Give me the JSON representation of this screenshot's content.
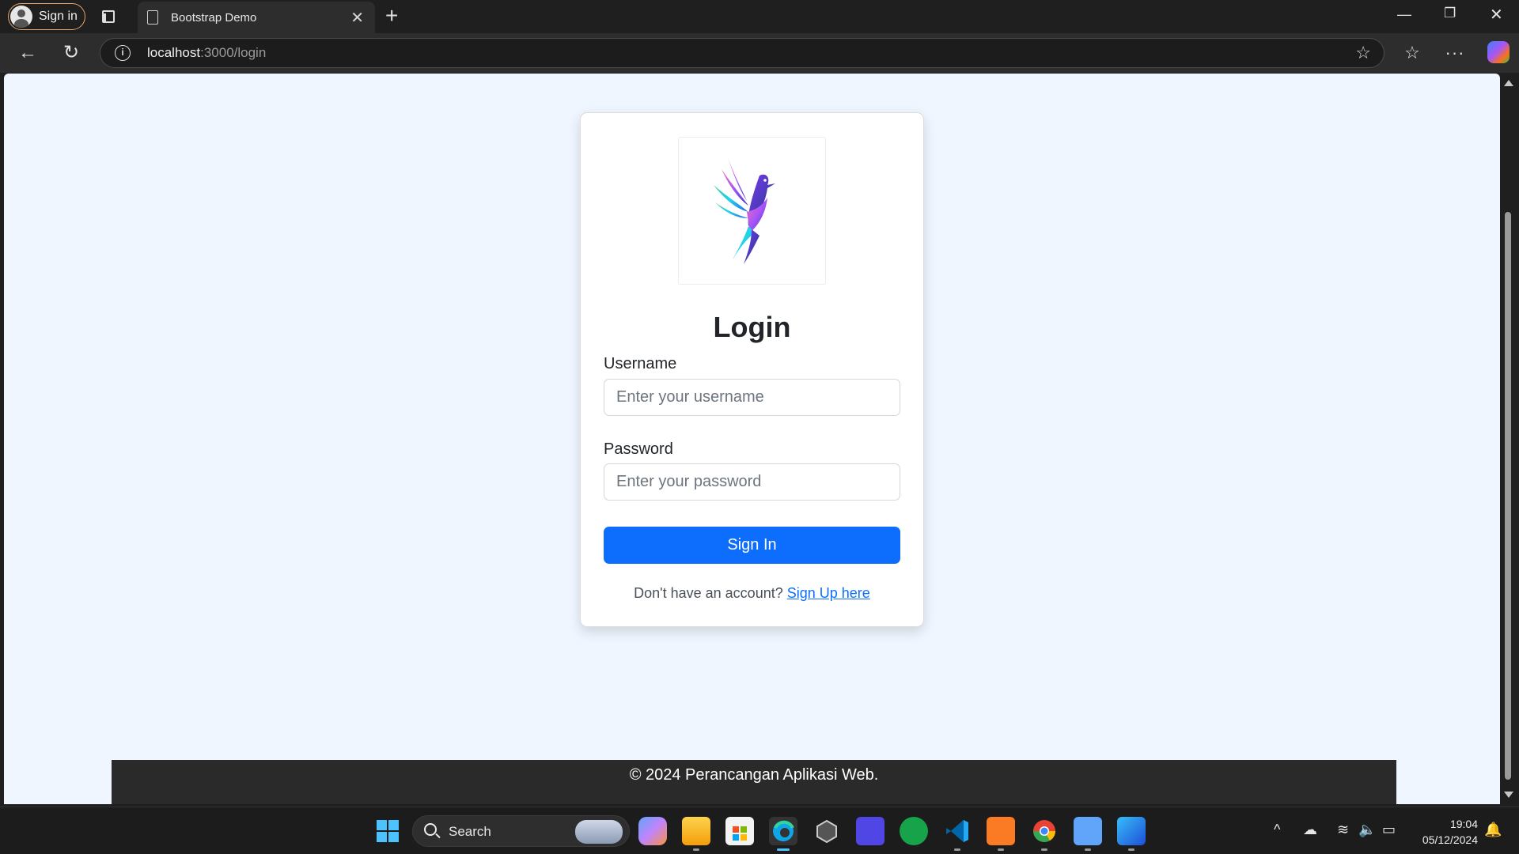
{
  "browser": {
    "profile_label": "Sign in",
    "tab_title": "Bootstrap Demo",
    "url_host": "localhost",
    "url_path": ":3000/login"
  },
  "login": {
    "title": "Login",
    "username_label": "Username",
    "username_placeholder": "Enter your username",
    "password_label": "Password",
    "password_placeholder": "Enter your password",
    "submit_label": "Sign In",
    "signup_prompt": "Don't have an account?",
    "signup_link": "Sign Up here"
  },
  "footer": {
    "text": "© 2024 Perancangan Aplikasi Web."
  },
  "taskbar": {
    "search_label": "Search",
    "time": "19:04",
    "date": "05/12/2024"
  },
  "colors": {
    "page_bg": "#eff6ff",
    "primary": "#0d6efd",
    "footer_bg": "#2a2a2a",
    "profile_border": "#e8a268"
  }
}
